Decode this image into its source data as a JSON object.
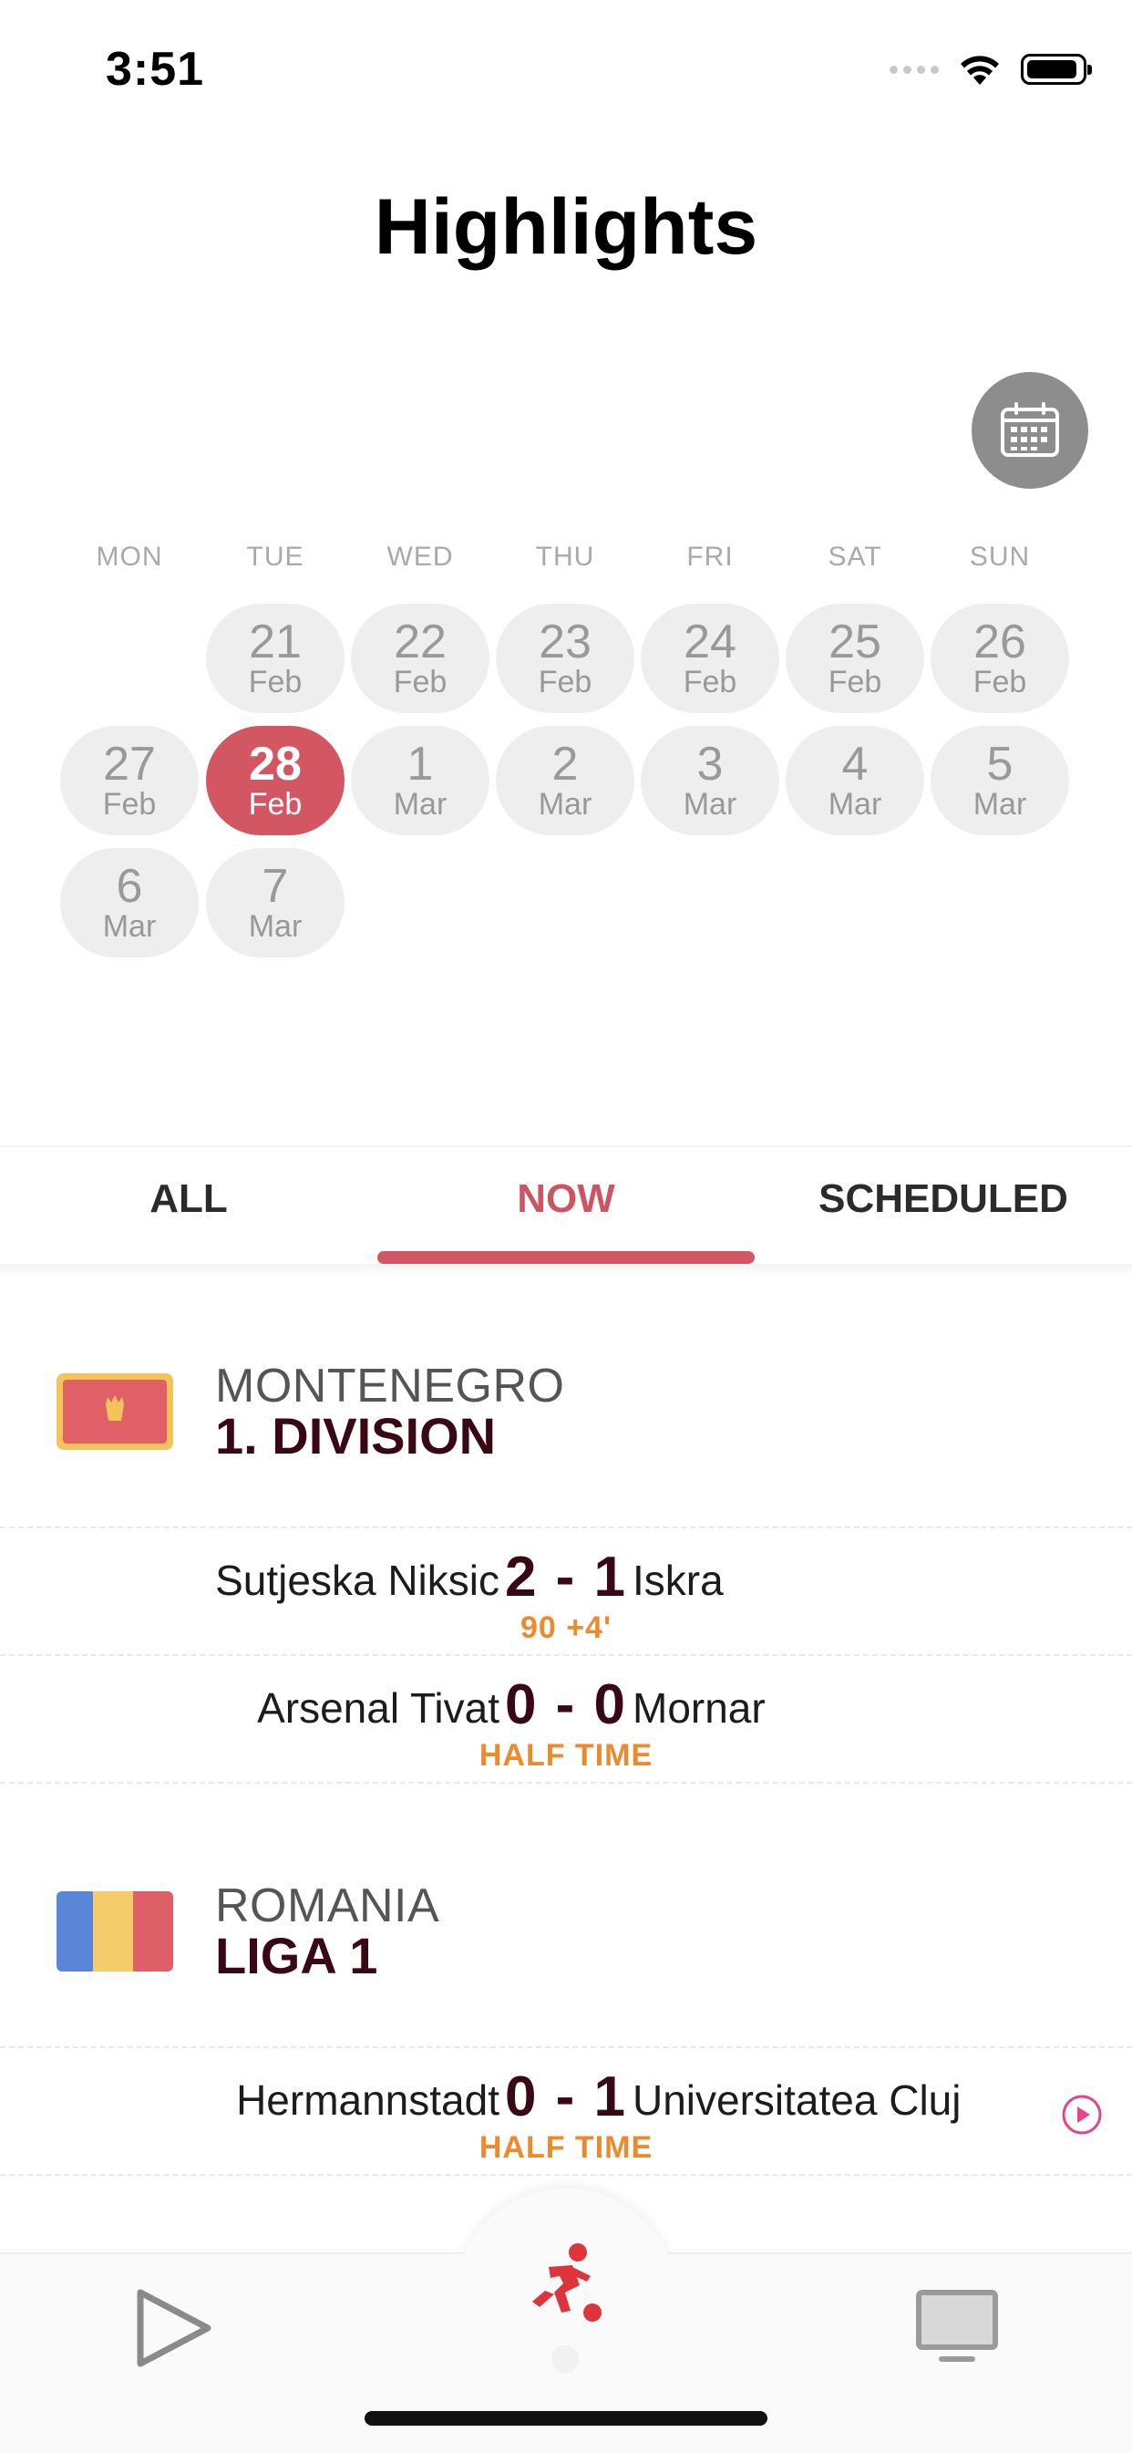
{
  "status_bar": {
    "time": "3:51"
  },
  "header": {
    "title": "Highlights"
  },
  "calendar": {
    "weekdays": [
      "MON",
      "TUE",
      "WED",
      "THU",
      "FRI",
      "SAT",
      "SUN"
    ],
    "days": [
      {
        "num": "21",
        "month": "Feb"
      },
      {
        "num": "22",
        "month": "Feb"
      },
      {
        "num": "23",
        "month": "Feb"
      },
      {
        "num": "24",
        "month": "Feb"
      },
      {
        "num": "25",
        "month": "Feb"
      },
      {
        "num": "26",
        "month": "Feb"
      },
      {
        "num": "27",
        "month": "Feb"
      },
      {
        "num": "28",
        "month": "Feb"
      },
      {
        "num": "1",
        "month": "Mar"
      },
      {
        "num": "2",
        "month": "Mar"
      },
      {
        "num": "3",
        "month": "Mar"
      },
      {
        "num": "4",
        "month": "Mar"
      },
      {
        "num": "5",
        "month": "Mar"
      },
      {
        "num": "6",
        "month": "Mar"
      },
      {
        "num": "7",
        "month": "Mar"
      }
    ],
    "selected": "28 Feb"
  },
  "tabs": [
    {
      "label": "ALL"
    },
    {
      "label": "NOW"
    },
    {
      "label": "SCHEDULED"
    }
  ],
  "active_tab": "NOW",
  "leagues": [
    {
      "country": "MONTENEGRO",
      "name": "1. DIVISION",
      "matches": [
        {
          "home": "Sutjeska Niksic",
          "score": "2 - 1",
          "away": "Iskra",
          "status": "90 +4'"
        },
        {
          "home": "Arsenal Tivat",
          "score": "0 - 0",
          "away": "Mornar",
          "status": "HALF TIME"
        }
      ]
    },
    {
      "country": "ROMANIA",
      "name": "LIGA 1",
      "matches": [
        {
          "home": "Hermannstadt",
          "score": "0 - 1",
          "away": "Universitatea Cluj",
          "status": "HALF TIME"
        }
      ]
    }
  ],
  "colors": {
    "accent": "#d25763",
    "status_orange": "#ec8a2c",
    "league_name": "#3a0714",
    "pill_bg": "#eeeeee",
    "calendar_button": "#8d8d8d"
  },
  "icons": {
    "calendar": "calendar-icon",
    "play": "play-icon",
    "soccer": "soccer-player-icon",
    "tv": "tv-icon",
    "video": "video-play-icon"
  }
}
